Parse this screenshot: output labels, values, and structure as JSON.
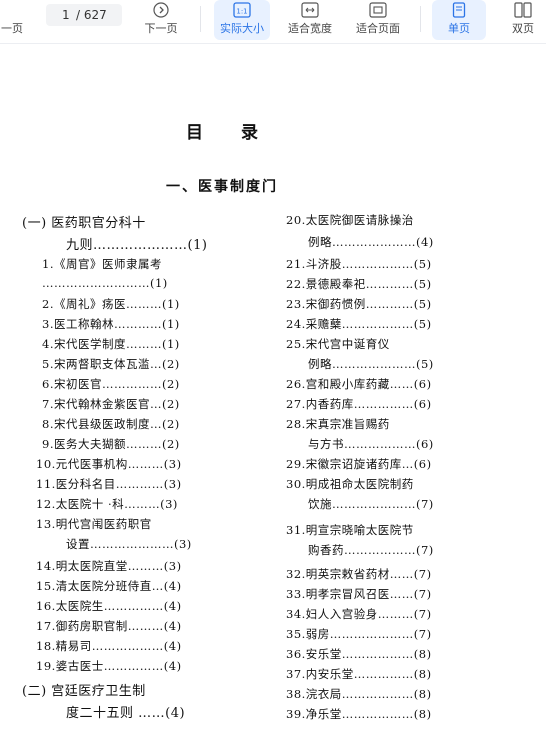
{
  "toolbar": {
    "prev_label": "一页",
    "page_current": "1",
    "page_total": "/ 627",
    "next_label": "下一页",
    "actual_size_label": "实际大小",
    "fit_width_label": "适合宽度",
    "fit_page_label": "适合页面",
    "single_page_label": "单页",
    "double_page_label": "双页"
  },
  "document": {
    "title": "目录",
    "section": "一、医事制度门",
    "left_column": [
      "(一) 医药职官分科十",
      "九则…………………(1)",
      "1.《周官》医师隶属考",
      "………………………(1)",
      "2.《周礼》疡医………(1)",
      "3.医工称翰林…………(1)",
      "4.宋代医学制度………(1)",
      "5.宋两督职支体瓦滥…(2)",
      "6.宋初医官……………(2)",
      "7.宋代翰林金紫医官…(2)",
      "8.宋代县级医政制度…(2)",
      "9.医务大夫猢额………(2)",
      "10.元代医事机构………(3)",
      "11.医分科名目…………(3)",
      "12.太医院十 ·科………(3)",
      "13.明代宫闱医药职官",
      "设置…………………(3)",
      "14.明太医院直堂………(3)",
      "15.清太医院分班侍直…(4)",
      "16.太医院生……………(4)",
      "17.御药房职官制………(4)",
      "18.精易司………………(4)",
      "19.婆古医士……………(4)",
      "(二) 宫廷医疗卫生制",
      "度二十五则 ……(4)"
    ],
    "right_column": [
      "20.太医院御医请脉操治",
      "例略…………………(4)",
      "21.斗济股………………(5)",
      "22.景德殿奉祀…………(5)",
      "23.宋御药惯例…………(5)",
      "24.采赡蘖………………(5)",
      "25.宋代宫中诞育仪",
      "例略…………………(5)",
      "26.宫和殿小库药藏……(6)",
      "27.内香药库……………(6)",
      "28.宋真宗准旨赐药",
      "与方书………………(6)",
      "29.宋徽宗诏旋诸药库…(6)",
      "30.明成祖命太医院制药",
      "饮施…………………(7)",
      "31.明宣宗晓喻太医院节",
      "购香药………………(7)",
      "32.明英宗敕省药材……(7)",
      "33.明孝宗冒风召医……(7)",
      "34.妇人入宫验身………(7)",
      "35.弱房…………………(7)",
      "36.安乐堂………………(8)",
      "37.内安乐堂……………(8)",
      "38.浣衣局………………(8)",
      "39.净乐堂………………(8)"
    ]
  }
}
